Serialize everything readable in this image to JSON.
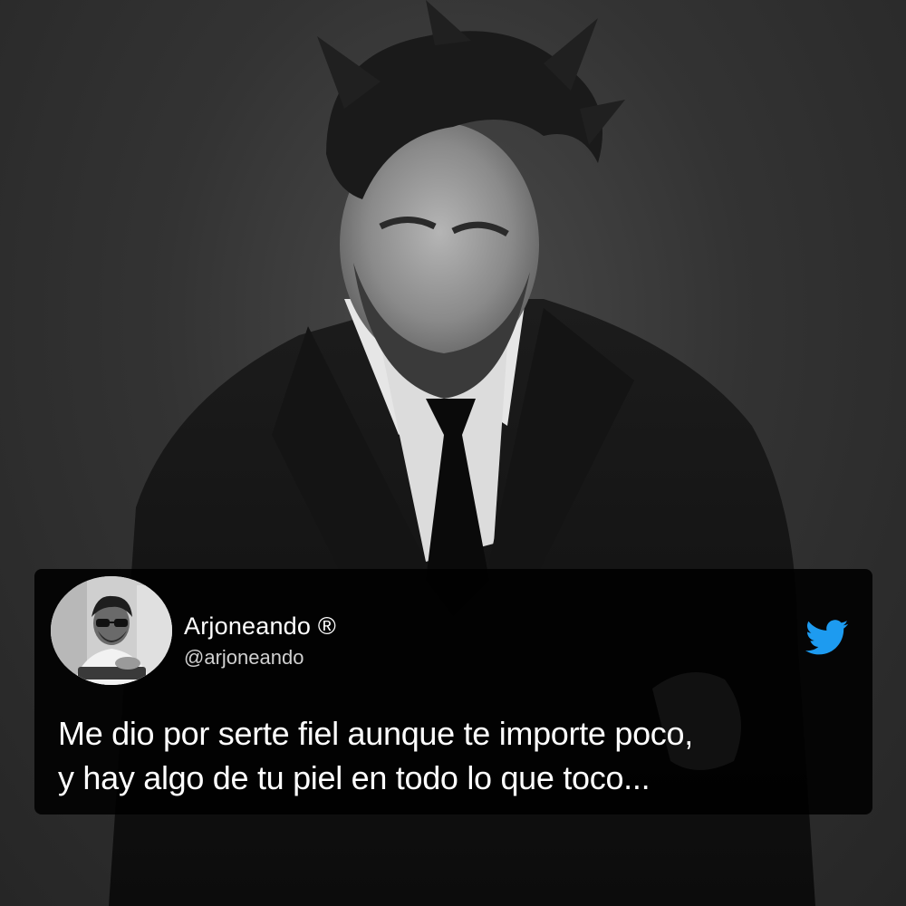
{
  "background_photo": {
    "icon": "portrait-photo-icon"
  },
  "tweet": {
    "display_name": "Arjoneando ®",
    "handle": "@arjoneando",
    "text_lines": [
      "Me dio por serte fiel aunque te importe poco,",
      "y hay algo de tu piel en todo lo que toco..."
    ],
    "avatar_icon": "avatar-photo-icon",
    "platform_icon": "twitter-bird-icon"
  },
  "colors": {
    "card_background": "#000000",
    "text": "#ffffff",
    "handle_text": "#d0d0d0",
    "twitter_blue": "#1d9bf0"
  }
}
